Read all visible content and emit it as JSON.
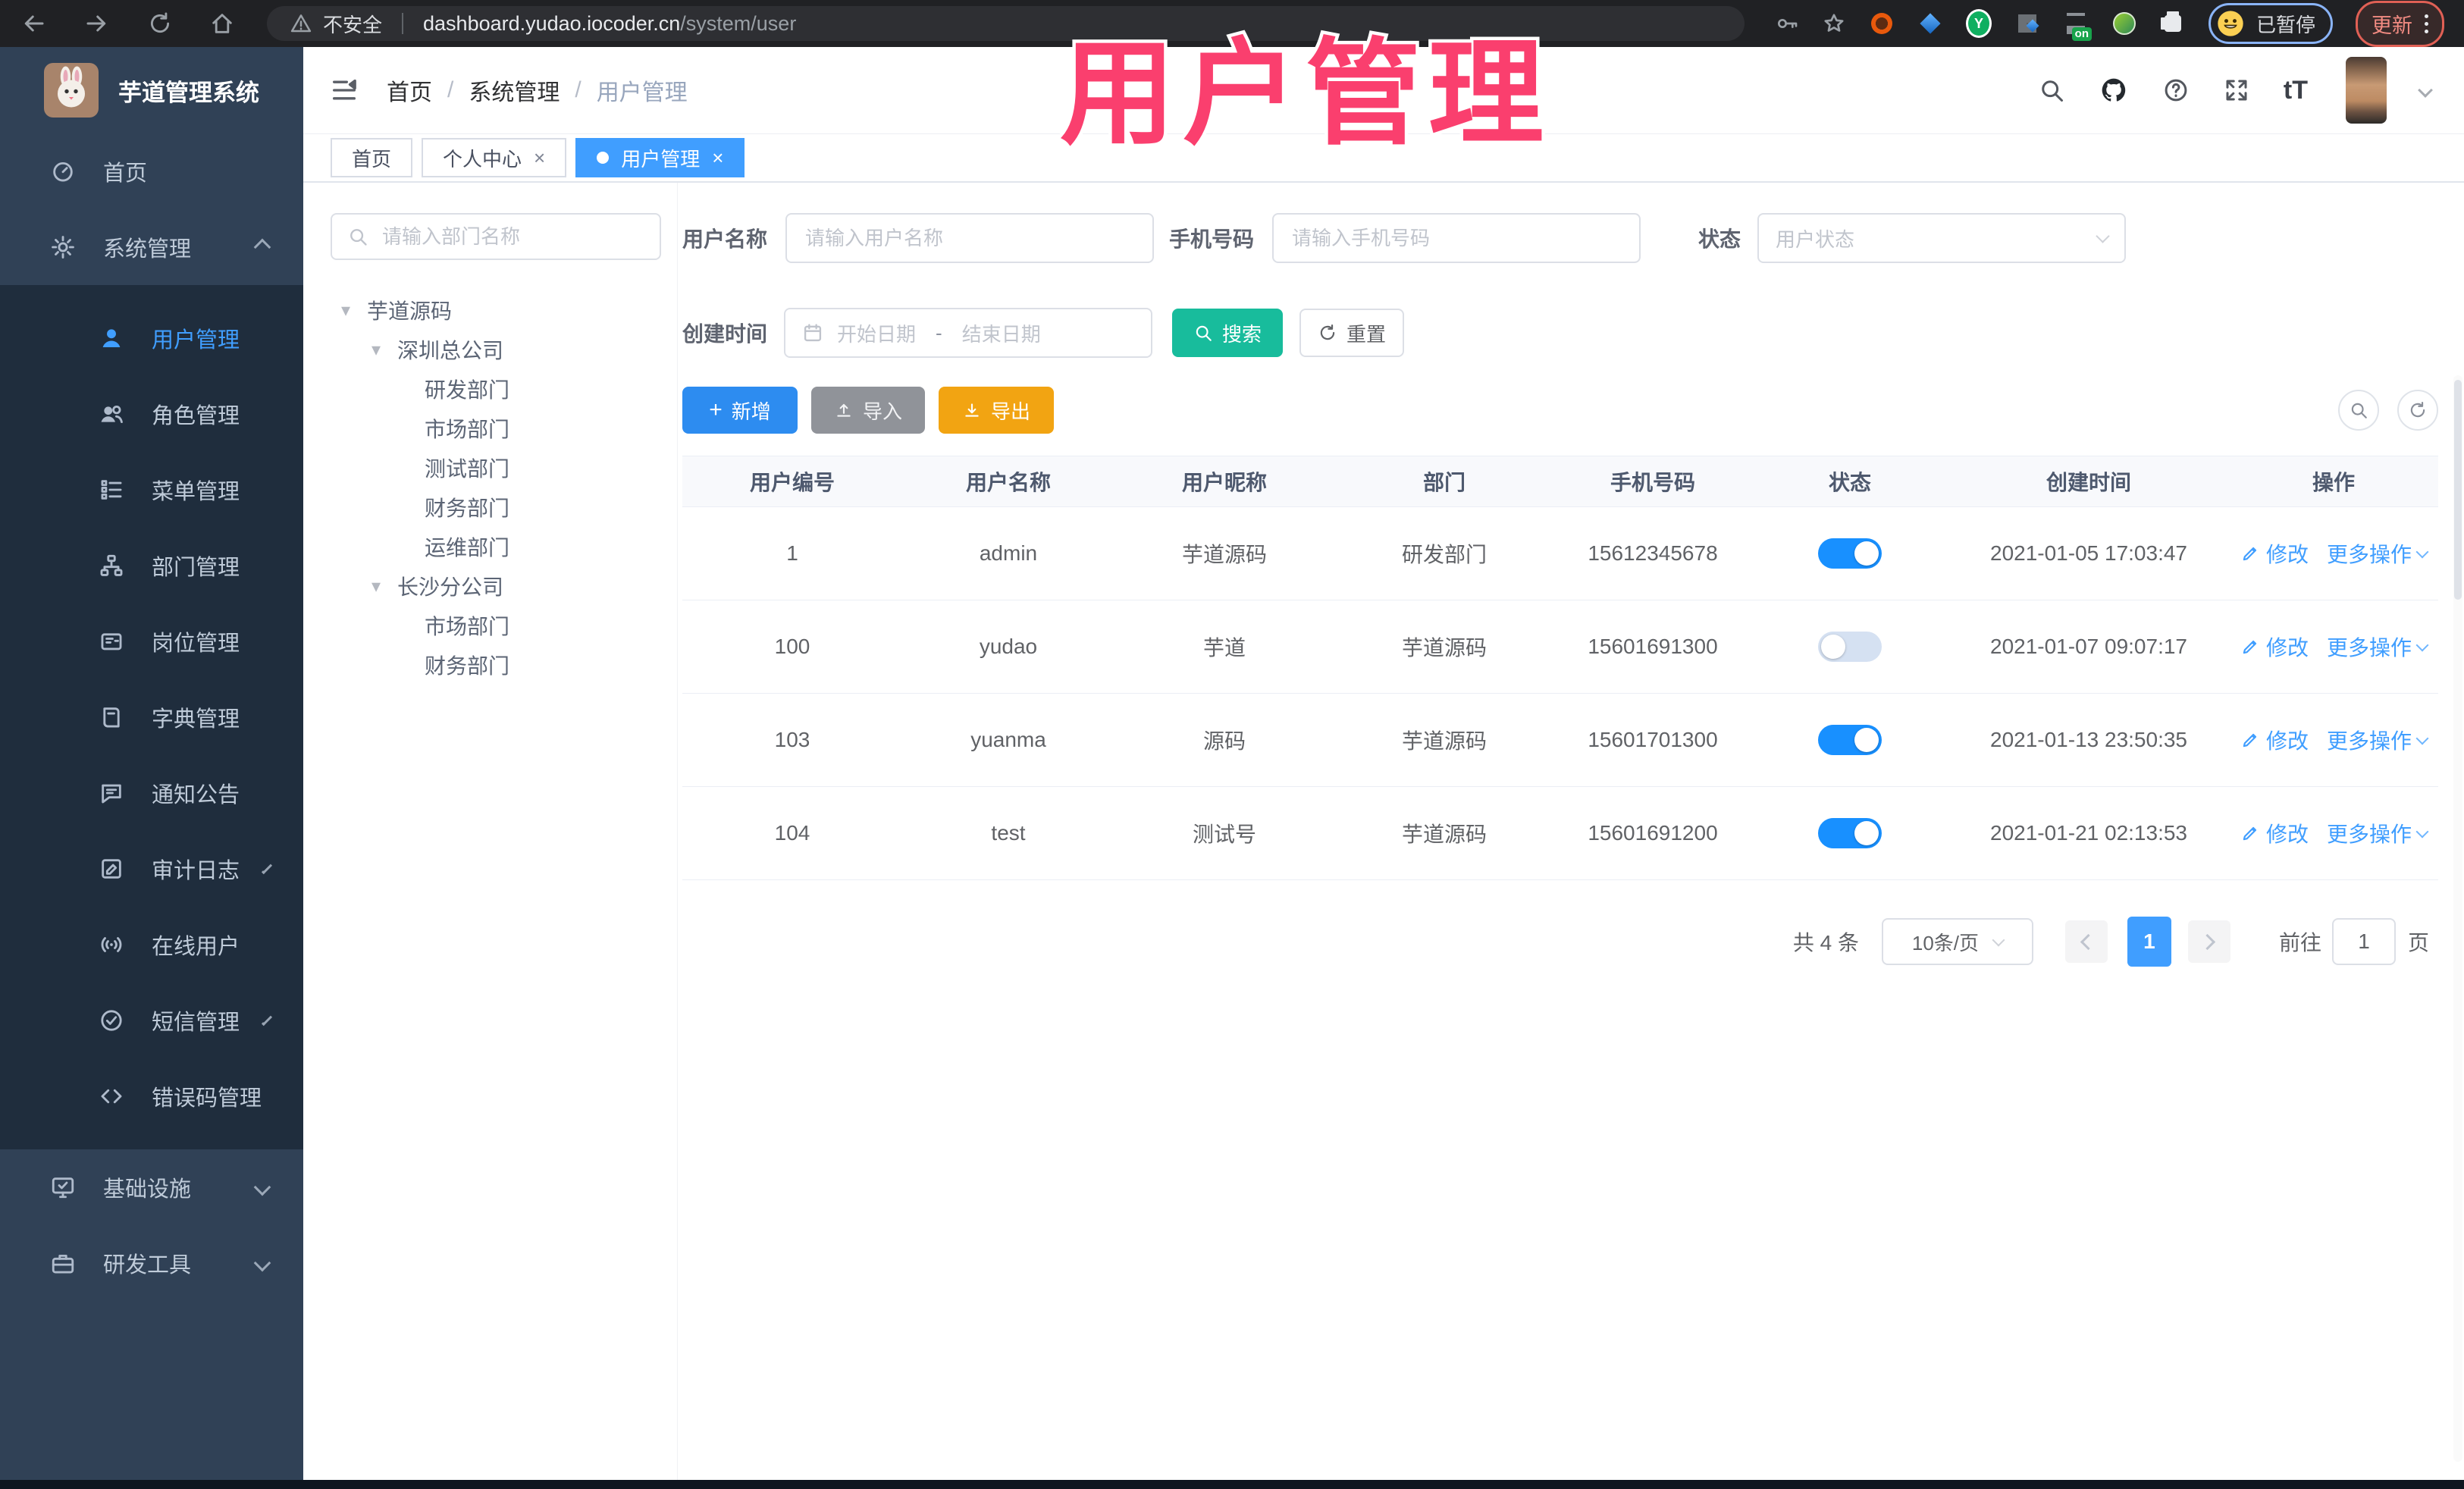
{
  "browser": {
    "security": "不安全",
    "url_host": "dashboard.yudao.iocoder.cn",
    "url_path": "/system/user",
    "profile_paused": "已暂停",
    "update": "更新",
    "extension_on_badge": "on"
  },
  "overlay": {
    "title": "用户管理",
    "color": "#fa3f6e"
  },
  "colors": {
    "primary": "#409eff",
    "toggle_on": "#1890ff",
    "search_button": "#18bc9c",
    "add_button": "#2d8cf0",
    "import_button": "#909399",
    "export_button": "#f2a412",
    "sidebar_bg": "#304156",
    "submenu_bg": "#1f2d3d",
    "active_tab_bg": "#409eff"
  },
  "sidebar": {
    "app_title": "芋道管理系统",
    "home": {
      "label": "首页",
      "icon": "dashboard"
    },
    "system": {
      "label": "系统管理",
      "icon": "gear"
    },
    "submenu": [
      {
        "label": "用户管理",
        "icon": "user"
      },
      {
        "label": "角色管理",
        "icon": "roles"
      },
      {
        "label": "菜单管理",
        "icon": "menu-tree"
      },
      {
        "label": "部门管理",
        "icon": "org-tree"
      },
      {
        "label": "岗位管理",
        "icon": "post"
      },
      {
        "label": "字典管理",
        "icon": "dictionary"
      },
      {
        "label": "通知公告",
        "icon": "announcement"
      },
      {
        "label": "审计日志",
        "icon": "audit-log"
      },
      {
        "label": "在线用户",
        "icon": "online-users"
      },
      {
        "label": "短信管理",
        "icon": "sms"
      },
      {
        "label": "错误码管理",
        "icon": "error-code"
      }
    ],
    "bottom": [
      {
        "label": "基础设施",
        "icon": "infrastructure"
      },
      {
        "label": "研发工具",
        "icon": "dev-tools"
      }
    ]
  },
  "breadcrumb": {
    "items": [
      "首页",
      "系统管理",
      "用户管理"
    ],
    "separator": "/"
  },
  "tabs": [
    {
      "label": "首页"
    },
    {
      "label": "个人中心"
    },
    {
      "label": "用户管理"
    }
  ],
  "dept": {
    "search_placeholder": "请输入部门名称",
    "nodes": [
      {
        "label": "芋道源码"
      },
      {
        "label": "深圳总公司"
      },
      {
        "label": "研发部门"
      },
      {
        "label": "市场部门"
      },
      {
        "label": "测试部门"
      },
      {
        "label": "财务部门"
      },
      {
        "label": "运维部门"
      },
      {
        "label": "长沙分公司"
      },
      {
        "label": "市场部门"
      },
      {
        "label": "财务部门"
      }
    ]
  },
  "filters": {
    "username_label": "用户名称",
    "username_placeholder": "请输入用户名称",
    "mobile_label": "手机号码",
    "mobile_placeholder": "请输入手机号码",
    "status_label": "状态",
    "status_placeholder": "用户状态",
    "created_label": "创建时间",
    "date_start": "开始日期",
    "date_sep": "-",
    "date_end": "结束日期",
    "search": "搜索",
    "reset": "重置"
  },
  "toolbar": {
    "add": "新增",
    "import": "导入",
    "export": "导出"
  },
  "table": {
    "columns": [
      "用户编号",
      "用户名称",
      "用户昵称",
      "部门",
      "手机号码",
      "状态",
      "创建时间",
      "操作"
    ],
    "edit": "修改",
    "more": "更多操作",
    "rows": [
      {
        "id": "1",
        "username": "admin",
        "nickname": "芋道源码",
        "dept": "研发部门",
        "mobile": "15612345678",
        "status_on": true,
        "created": "2021-01-05 17:03:47"
      },
      {
        "id": "100",
        "username": "yudao",
        "nickname": "芋道",
        "dept": "芋道源码",
        "mobile": "15601691300",
        "status_on": false,
        "created": "2021-01-07 09:07:17"
      },
      {
        "id": "103",
        "username": "yuanma",
        "nickname": "源码",
        "dept": "芋道源码",
        "mobile": "15601701300",
        "status_on": true,
        "created": "2021-01-13 23:50:35"
      },
      {
        "id": "104",
        "username": "test",
        "nickname": "测试号",
        "dept": "芋道源码",
        "mobile": "15601691200",
        "status_on": true,
        "created": "2021-01-21 02:13:53"
      }
    ]
  },
  "pagination": {
    "total": "共 4 条",
    "page_size": "10条/页",
    "page": "1",
    "goto_label": "前往",
    "page_unit": "页"
  }
}
